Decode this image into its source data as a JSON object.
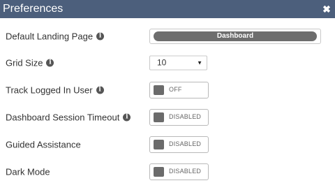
{
  "dialog": {
    "title": "Preferences",
    "close_icon": "times-icon",
    "header_color": "#4c5f7c"
  },
  "settings": {
    "default_landing_page": {
      "label": "Default Landing Page",
      "value": "Dashboard"
    },
    "grid_size": {
      "label": "Grid Size",
      "value": "10"
    },
    "track_logged_in_user": {
      "label": "Track Logged In User",
      "state": "OFF"
    },
    "dashboard_session_timeout": {
      "label": "Dashboard Session Timeout",
      "state": "DISABLED"
    },
    "guided_assistance": {
      "label": "Guided Assistance",
      "state": "DISABLED"
    },
    "dark_mode": {
      "label": "Dark Mode",
      "state": "DISABLED"
    }
  },
  "icons": {
    "info": "info-icon",
    "dropdown": "caret-down-icon"
  }
}
